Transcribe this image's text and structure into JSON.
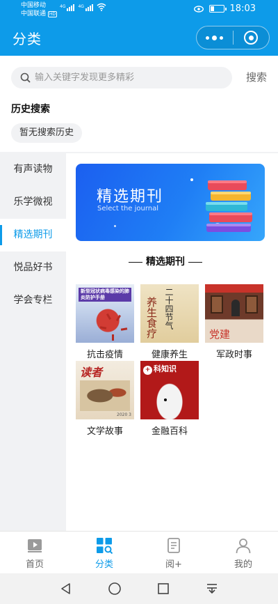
{
  "status_bar": {
    "carrier_1": "中国移动",
    "carrier_2": "中国联通",
    "hd_badge": "HD",
    "network_1": "4G",
    "network_2": "4G",
    "time": "18:03"
  },
  "header": {
    "title": "分类"
  },
  "search": {
    "placeholder": "输入关键字发现更多精彩",
    "button_label": "搜索",
    "history_title": "历史搜索",
    "history_empty": "暂无搜索历史"
  },
  "sidebar": {
    "items": [
      {
        "label": "有声读物"
      },
      {
        "label": "乐学微视"
      },
      {
        "label": "精选期刊",
        "active": true
      },
      {
        "label": "悦品好书"
      },
      {
        "label": "学会专栏"
      }
    ]
  },
  "banner": {
    "title": "精选期刊",
    "subtitle": "Select the journal"
  },
  "section": {
    "title": "精选期刊"
  },
  "categories": [
    {
      "label": "抗击疫情",
      "cover_text": "新型冠状病毒感染的肺炎防护手册"
    },
    {
      "label": "健康养生",
      "cover_text": "养生食疗",
      "cover_text_2": "二十四节气"
    },
    {
      "label": "军政时事",
      "cover_text": "党建"
    },
    {
      "label": "文学故事",
      "cover_text": "读者",
      "cover_issue": "2020 3"
    },
    {
      "label": "金融百科",
      "cover_text": "科知识"
    }
  ],
  "tabbar": {
    "items": [
      {
        "label": "首页",
        "icon": "play-icon"
      },
      {
        "label": "分类",
        "icon": "grid-icon",
        "active": true
      },
      {
        "label": "阅+",
        "icon": "book-icon"
      },
      {
        "label": "我的",
        "icon": "person-icon"
      }
    ]
  },
  "colors": {
    "accent": "#0d9be9",
    "banner_start": "#1b5ff0",
    "banner_end": "#36a6fb"
  }
}
